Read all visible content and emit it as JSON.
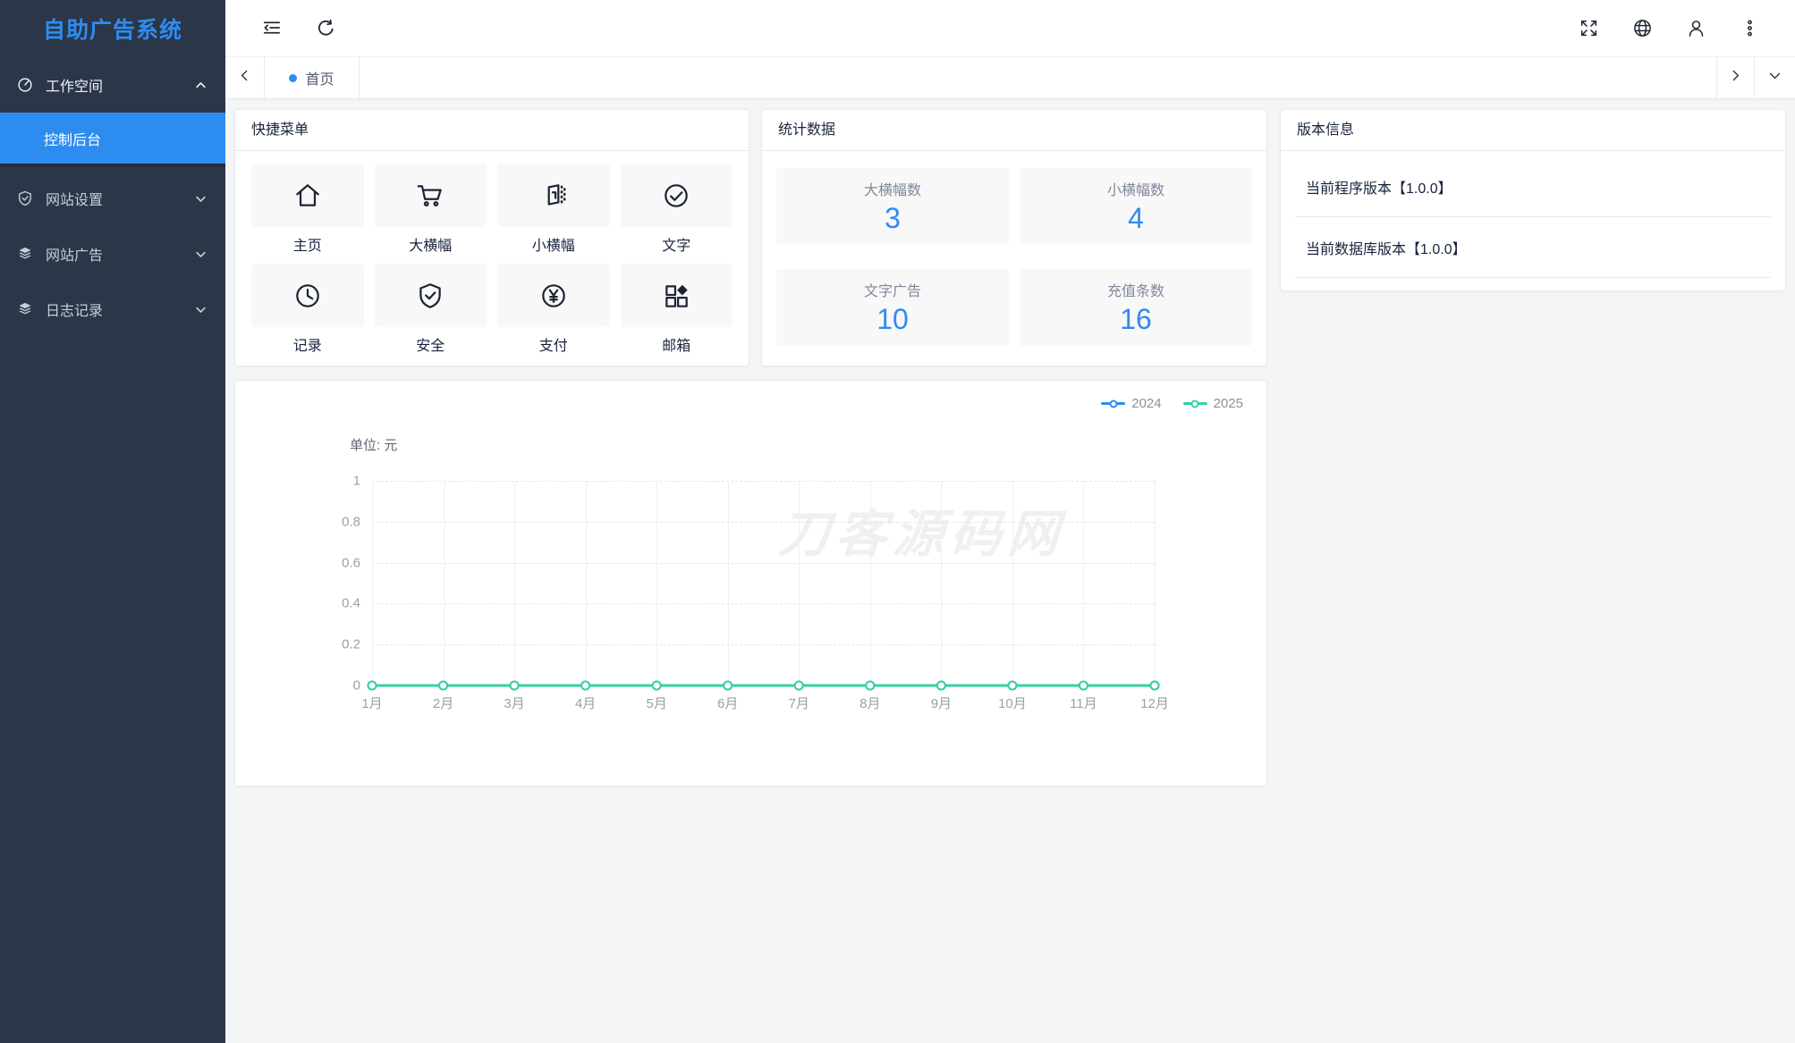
{
  "app": {
    "name": "自助广告系统"
  },
  "colors": {
    "accent": "#2d8cf0",
    "sidebar_bg": "#2b3648",
    "active_item_bg": "#2d8cf0",
    "stat_number": "#2d8cf0",
    "content_bg": "#f4f5f7"
  },
  "sidebar": {
    "logo": "自助广告系统",
    "items": [
      {
        "label": "工作空间",
        "icon": "gauge-icon",
        "state": "expanded"
      },
      {
        "label": "控制后台",
        "active": true,
        "parent": "工作空间"
      },
      {
        "label": "网站设置",
        "icon": "shield-icon",
        "state": "collapsed"
      },
      {
        "label": "网站广告",
        "icon": "layers-icon",
        "state": "collapsed"
      },
      {
        "label": "日志记录",
        "icon": "layers-icon",
        "state": "collapsed"
      }
    ]
  },
  "header": {
    "left_icons": [
      "menu-fold-icon",
      "refresh-icon"
    ],
    "right_icons": [
      "fullscreen-icon",
      "globe-icon",
      "user-icon",
      "more-vertical-icon"
    ]
  },
  "tabbar": {
    "tabs": [
      {
        "label": "首页",
        "active": true
      }
    ]
  },
  "quick_menu": {
    "title": "快捷菜单",
    "items": [
      {
        "label": "主页",
        "icon": "home-icon"
      },
      {
        "label": "大横幅",
        "icon": "cart-icon"
      },
      {
        "label": "小横幅",
        "icon": "banner-icon"
      },
      {
        "label": "文字",
        "icon": "check-circle-icon"
      },
      {
        "label": "记录",
        "icon": "clock-icon"
      },
      {
        "label": "安全",
        "icon": "shield-check-icon"
      },
      {
        "label": "支付",
        "icon": "yen-circle-icon"
      },
      {
        "label": "邮箱",
        "icon": "grid-diamond-icon"
      }
    ]
  },
  "stats": {
    "title": "统计数据",
    "items": [
      {
        "label": "大横幅数",
        "value": "3"
      },
      {
        "label": "小横幅数",
        "value": "4"
      },
      {
        "label": "文字广告",
        "value": "10"
      },
      {
        "label": "充值条数",
        "value": "16"
      }
    ]
  },
  "version": {
    "title": "版本信息",
    "rows": [
      {
        "text": "当前程序版本【1.0.0】"
      },
      {
        "text": "当前数据库版本【1.0.0】"
      }
    ]
  },
  "chart_data": {
    "type": "line",
    "unit_label": "单位: 元",
    "x": [
      "1月",
      "2月",
      "3月",
      "4月",
      "5月",
      "6月",
      "7月",
      "8月",
      "9月",
      "10月",
      "11月",
      "12月"
    ],
    "series": [
      {
        "name": "2024",
        "color": "#2d8cf0",
        "values": [
          0,
          0,
          0,
          0,
          0,
          0,
          0,
          0,
          0,
          0,
          0,
          0
        ]
      },
      {
        "name": "2025",
        "color": "#36cfa5",
        "values": [
          0,
          0,
          0,
          0,
          0,
          0,
          0,
          0,
          0,
          0,
          0,
          0
        ]
      }
    ],
    "ylim": [
      0,
      1
    ],
    "yticks": [
      0,
      0.2,
      0.4,
      0.6,
      0.8,
      1
    ],
    "grid": true,
    "legend_position": "top-right",
    "watermark": "刀客源码网"
  }
}
